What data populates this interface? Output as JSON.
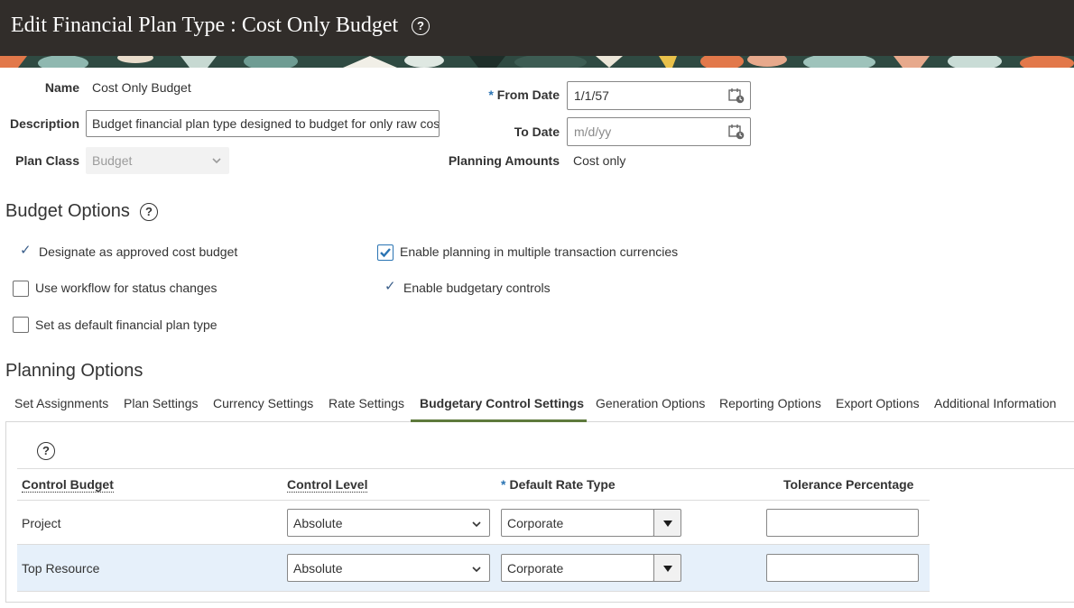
{
  "header": {
    "title": "Edit Financial Plan Type : Cost Only Budget",
    "help_glyph": "?"
  },
  "colors": {
    "header_bg": "#312d2a",
    "accent_blue": "#2a74b3",
    "tab_underline": "#5e7a3c",
    "selected_row_bg": "#e6f0fa"
  },
  "form": {
    "name_label": "Name",
    "name_value": "Cost Only Budget",
    "description_label": "Description",
    "description_value": "Budget financial plan type designed to budget for only raw costs",
    "plan_class_label": "Plan Class",
    "plan_class_value": "Budget",
    "from_date_required": "*",
    "from_date_label": "From Date",
    "from_date_value": "1/1/57",
    "to_date_label": "To Date",
    "to_date_placeholder": "m/d/yy",
    "planning_amounts_label": "Planning Amounts",
    "planning_amounts_value": "Cost only"
  },
  "budget_options": {
    "heading": "Budget Options",
    "help_glyph": "?",
    "check_glyph": "✓",
    "designate_label": "Designate as approved cost budget",
    "designate_checked": true,
    "workflow_label": "Use workflow for status changes",
    "workflow_checked": false,
    "default_label": "Set as default financial plan type",
    "default_checked": false,
    "multi_currency_label": "Enable planning in multiple transaction currencies",
    "multi_currency_checked": true,
    "budgetary_controls_label": "Enable budgetary controls",
    "budgetary_controls_checked": true
  },
  "planning_options": {
    "heading": "Planning Options",
    "tabs": [
      {
        "label": "Set Assignments"
      },
      {
        "label": "Plan Settings"
      },
      {
        "label": "Currency Settings"
      },
      {
        "label": "Rate Settings"
      },
      {
        "label": "Budgetary Control Settings"
      },
      {
        "label": "Generation Options"
      },
      {
        "label": "Reporting Options"
      },
      {
        "label": "Export Options"
      },
      {
        "label": "Additional Information"
      }
    ],
    "active_tab": "Budgetary Control Settings"
  },
  "table": {
    "help_glyph": "?",
    "col_control_budget": "Control Budget",
    "col_control_level": "Control Level",
    "col_default_rate_type_required": "*",
    "col_default_rate_type": "Default Rate Type",
    "col_tolerance": "Tolerance Percentage",
    "rows": [
      {
        "control_budget": "Project",
        "control_level": "Absolute",
        "rate_type": "Corporate",
        "tolerance": "",
        "selected": false
      },
      {
        "control_budget": "Top Resource",
        "control_level": "Absolute",
        "rate_type": "Corporate",
        "tolerance": "",
        "selected": true
      }
    ]
  }
}
